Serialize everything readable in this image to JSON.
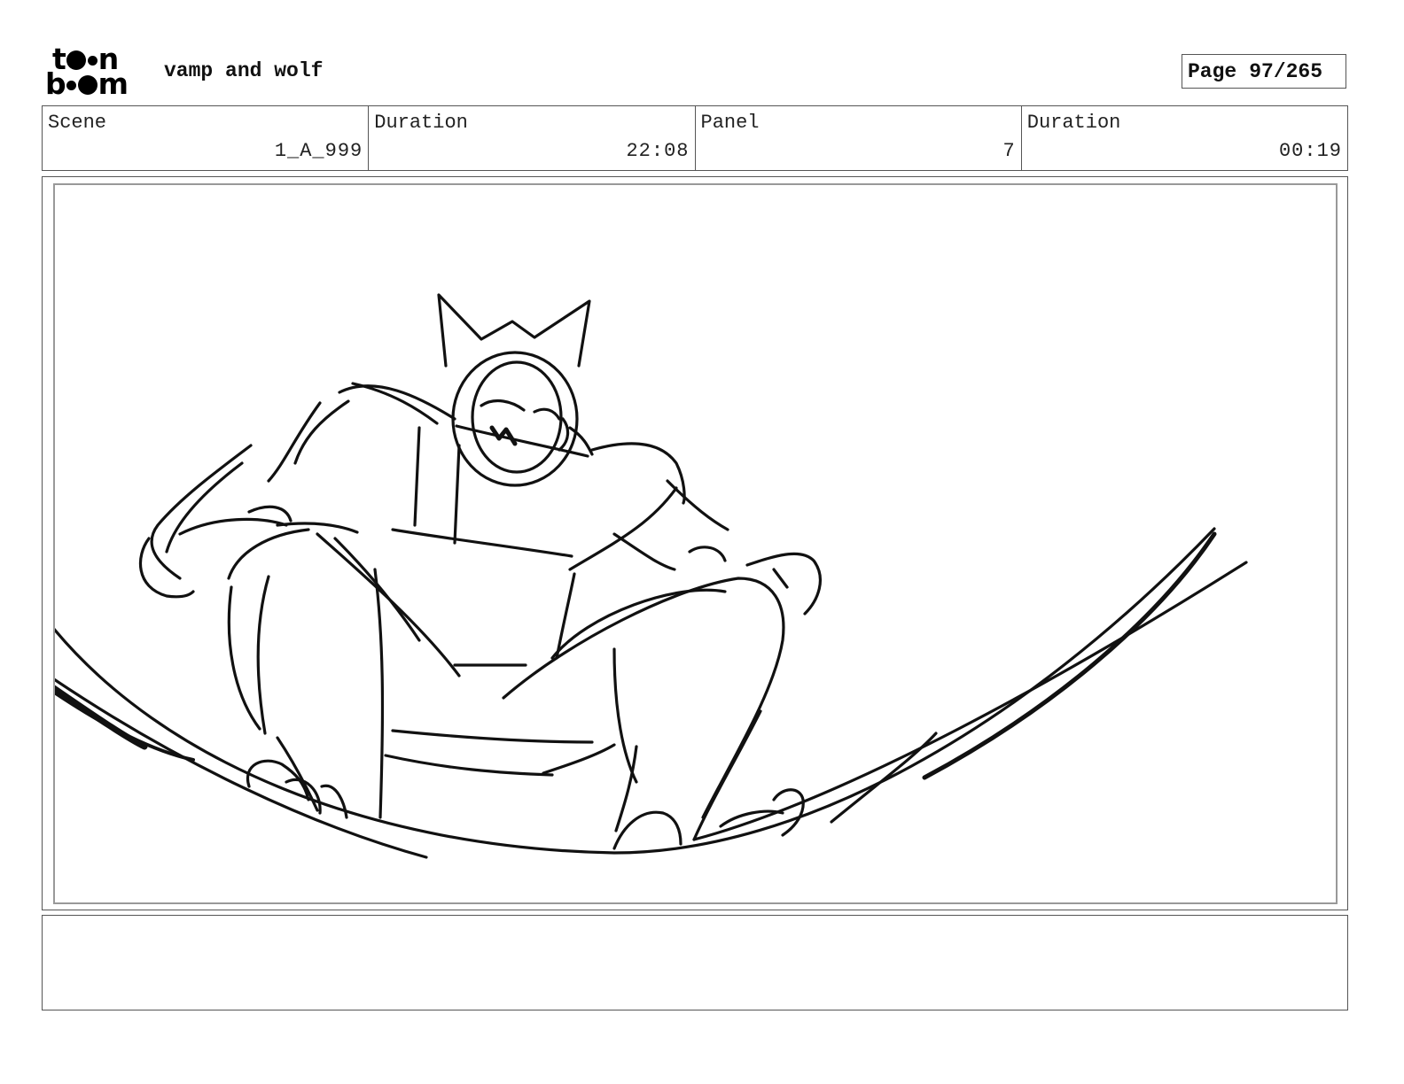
{
  "header": {
    "logo_line1": "toon",
    "logo_line2": "boom",
    "project_title": "vamp and wolf",
    "page_label": "Page",
    "page_value": "97/265"
  },
  "info": {
    "scene_label": "Scene",
    "scene_value": "1_A_999",
    "scene_duration_label": "Duration",
    "scene_duration_value": "22:08",
    "panel_label": "Panel",
    "panel_value": "7",
    "panel_duration_label": "Duration",
    "panel_duration_value": "00:19"
  },
  "notes": {
    "text": ""
  }
}
